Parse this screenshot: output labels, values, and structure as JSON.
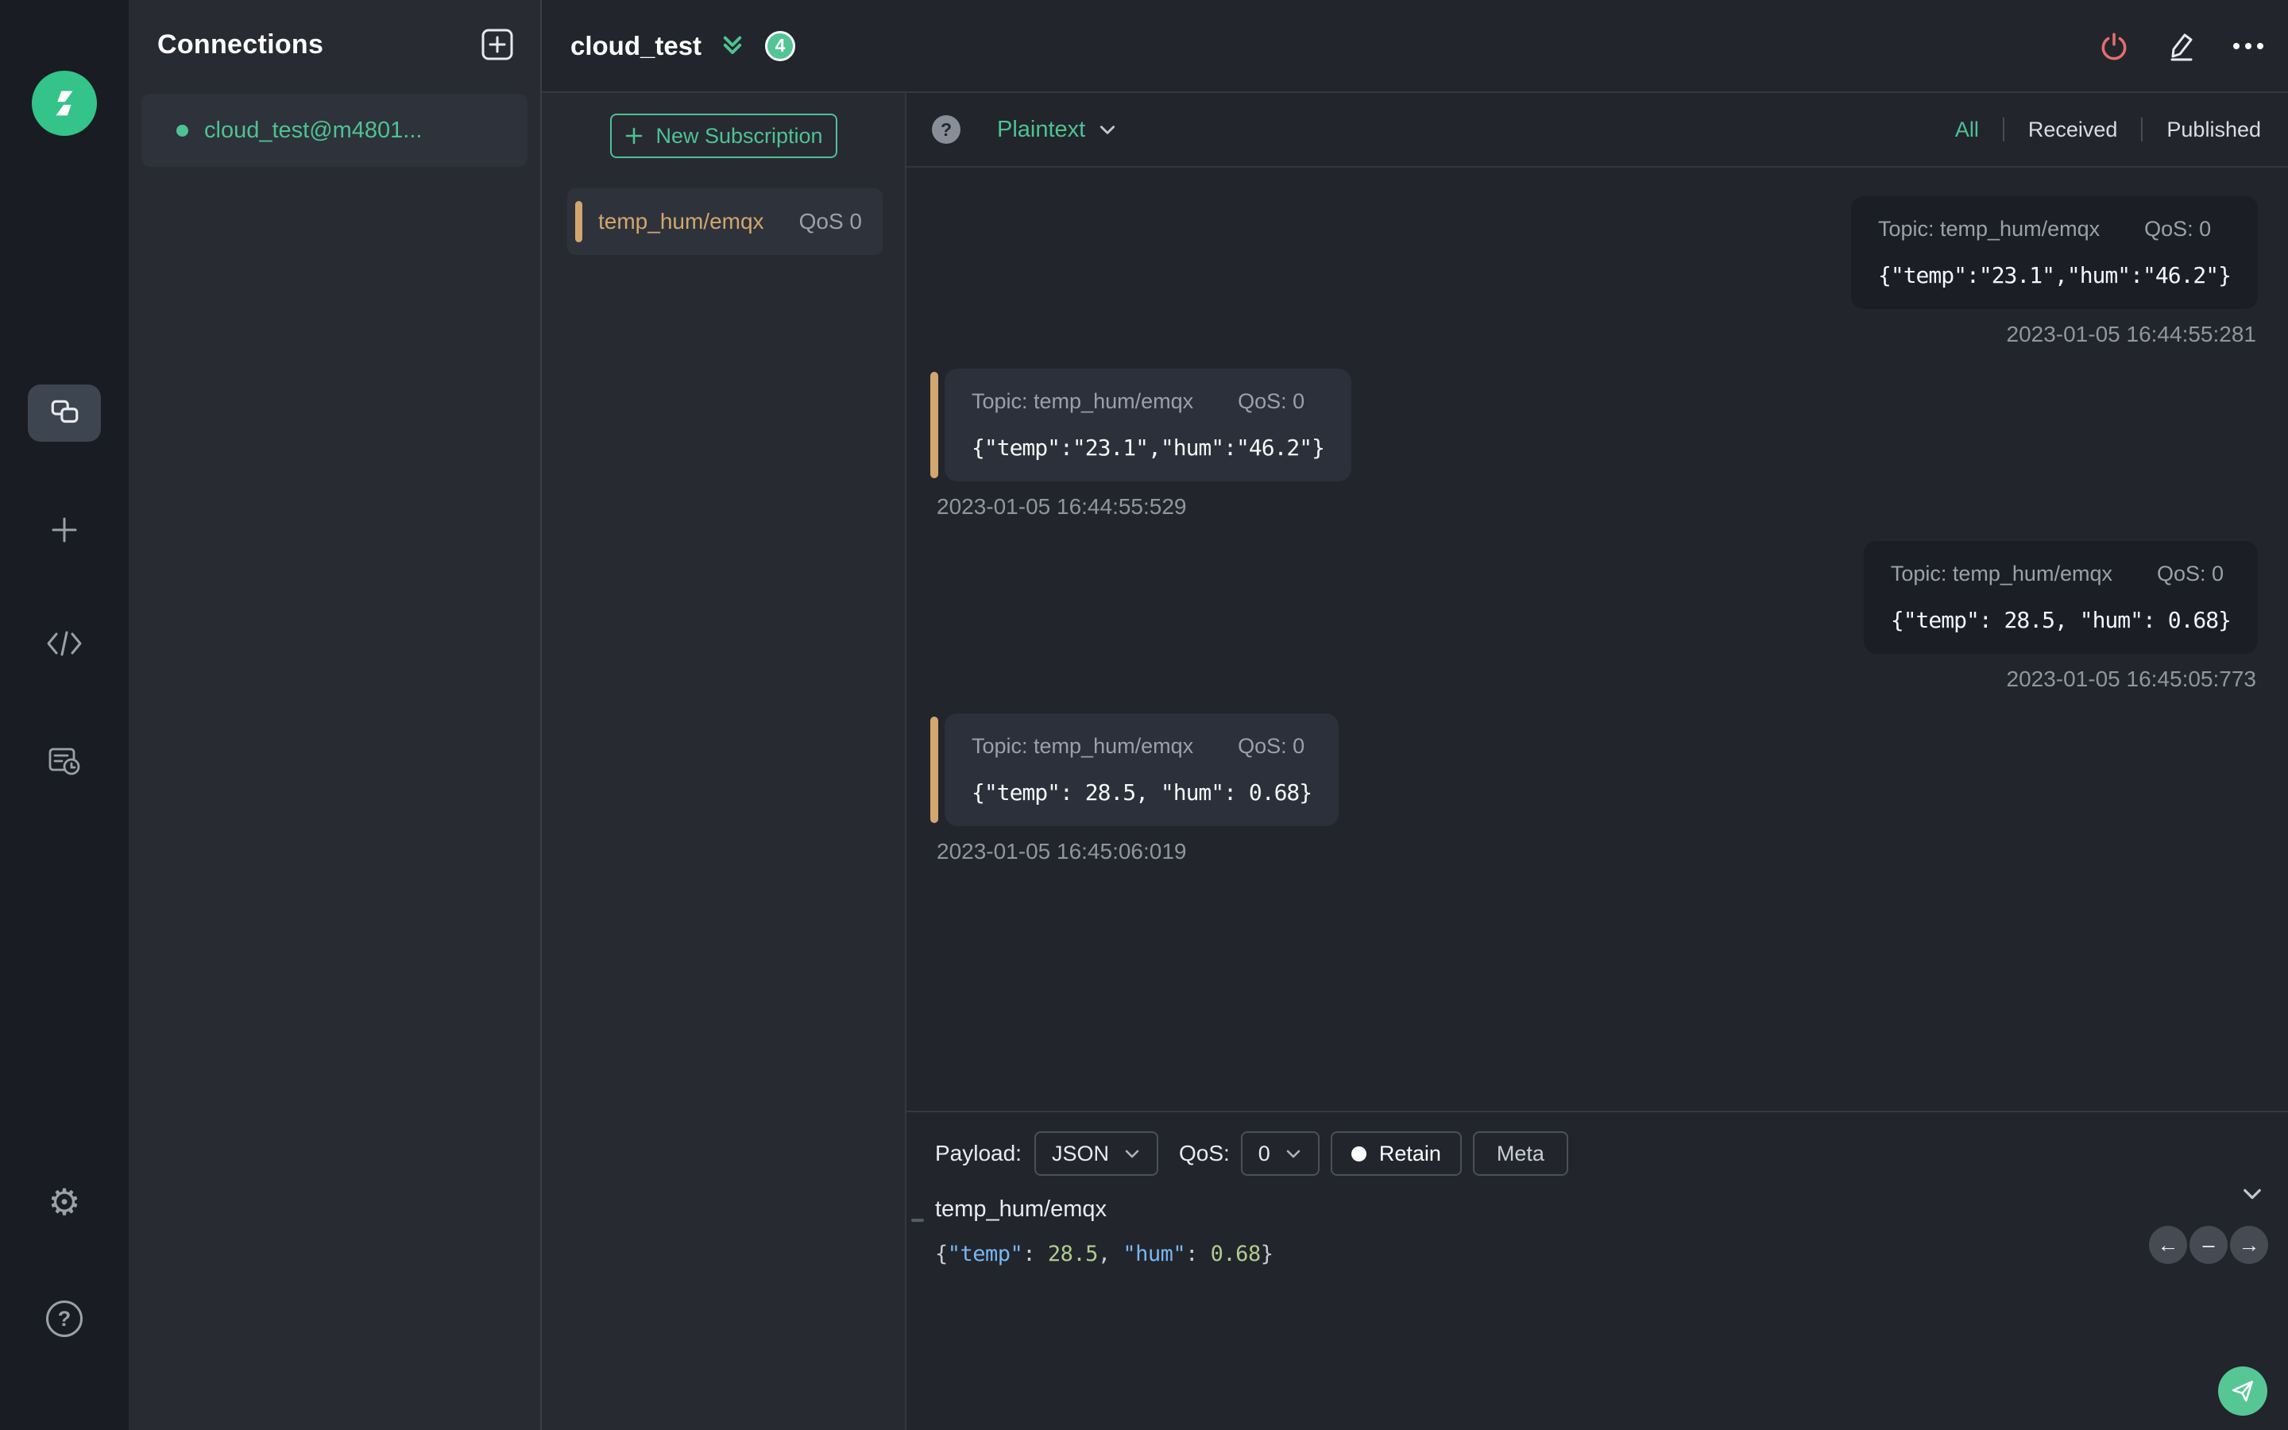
{
  "colors": {
    "accent_green": "#4ec291",
    "logo_green": "#34c388",
    "topic_accent": "#d2a66e",
    "disconnect_red": "#e36e6e",
    "json_key": "#79b6f2",
    "json_number": "#b0cb8c",
    "json_punct": "#c7ccd3"
  },
  "connections_panel": {
    "title": "Connections",
    "connections": [
      {
        "name": "cloud_test@m4801...",
        "active": true
      }
    ]
  },
  "topbar": {
    "title": "cloud_test",
    "unread_badge": "4"
  },
  "subscriptions_panel": {
    "new_subscription_label": "New Subscription",
    "subscriptions": [
      {
        "topic": "temp_hum/emqx",
        "qos": "QoS 0"
      }
    ]
  },
  "messages_toolbar": {
    "payload_format": "Plaintext",
    "filters": {
      "all": "All",
      "received": "Received",
      "published": "Published",
      "active": "All"
    }
  },
  "messages": [
    {
      "direction": "publish",
      "topic": "Topic: temp_hum/emqx",
      "qos": "QoS: 0",
      "payload": "{\"temp\":\"23.1\",\"hum\":\"46.2\"}",
      "timestamp": "2023-01-05 16:44:55:281"
    },
    {
      "direction": "receive",
      "topic": "Topic: temp_hum/emqx",
      "qos": "QoS: 0",
      "payload": "{\"temp\":\"23.1\",\"hum\":\"46.2\"}",
      "timestamp": "2023-01-05 16:44:55:529"
    },
    {
      "direction": "publish",
      "topic": "Topic: temp_hum/emqx",
      "qos": "QoS: 0",
      "payload": "{\"temp\": 28.5, \"hum\": 0.68}",
      "timestamp": "2023-01-05 16:45:05:773"
    },
    {
      "direction": "receive",
      "topic": "Topic: temp_hum/emqx",
      "qos": "QoS: 0",
      "payload": "{\"temp\": 28.5, \"hum\": 0.68}",
      "timestamp": "2023-01-05 16:45:06:019"
    }
  ],
  "publish_bar": {
    "payload_label": "Payload:",
    "payload_format": "JSON",
    "qos_label": "QoS:",
    "qos_value": "0",
    "retain_label": "Retain",
    "meta_label": "Meta",
    "topic_value": "temp_hum/emqx",
    "payload_tokens": [
      {
        "text": "{",
        "type": "punct"
      },
      {
        "text": "\"temp\"",
        "type": "key"
      },
      {
        "text": ": ",
        "type": "punct"
      },
      {
        "text": "28.5",
        "type": "number"
      },
      {
        "text": ", ",
        "type": "punct"
      },
      {
        "text": "\"hum\"",
        "type": "key"
      },
      {
        "text": ": ",
        "type": "punct"
      },
      {
        "text": "0.68",
        "type": "number"
      },
      {
        "text": "}",
        "type": "punct"
      }
    ]
  }
}
